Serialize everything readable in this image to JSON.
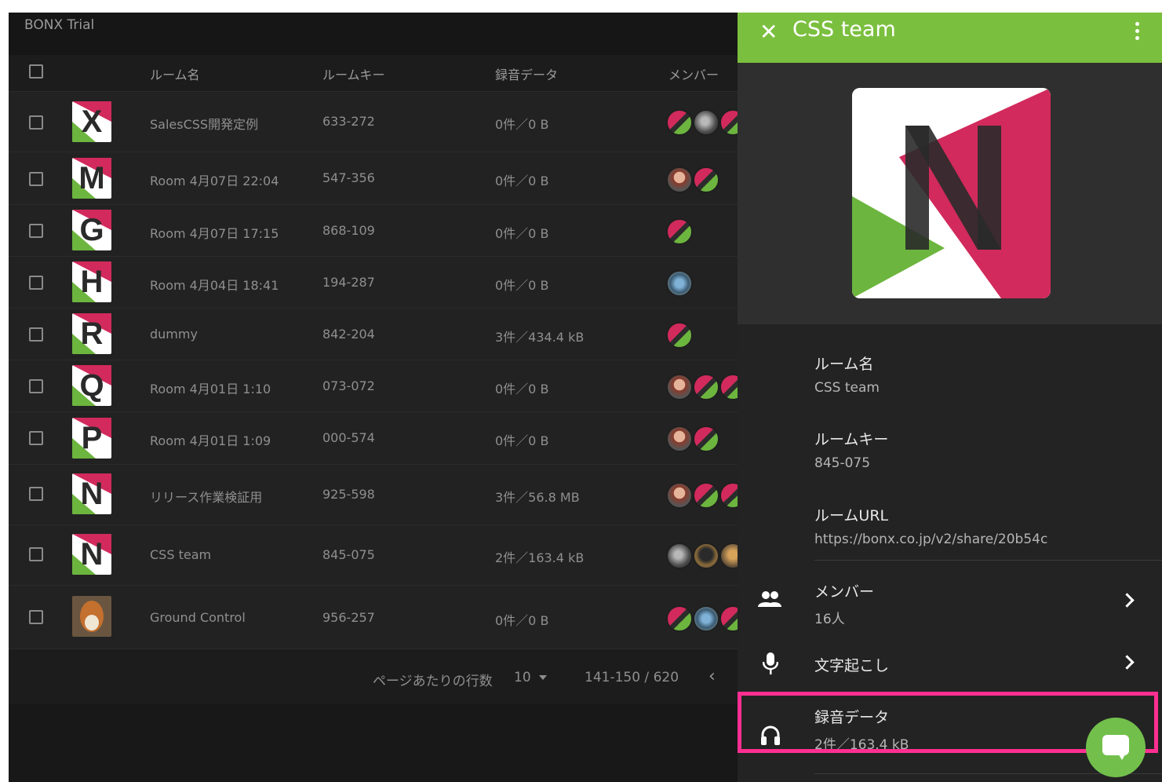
{
  "app": {
    "title": "BONX Trial"
  },
  "table": {
    "headers": {
      "name": "ルーム名",
      "key": "ルームキー",
      "recording": "録音データ",
      "members": "メンバー"
    },
    "rows": [
      {
        "avatar": "X",
        "name": "SalesCSS開発定例",
        "key": "633-272",
        "recording": "0件／0 B"
      },
      {
        "avatar": "M",
        "name": "Room 4月07日 22:04",
        "key": "547-356",
        "recording": "0件／0 B"
      },
      {
        "avatar": "G",
        "name": "Room 4月07日 17:15",
        "key": "868-109",
        "recording": "0件／0 B"
      },
      {
        "avatar": "H",
        "name": "Room 4月04日 18:41",
        "key": "194-287",
        "recording": "0件／0 B"
      },
      {
        "avatar": "R",
        "name": "dummy",
        "key": "842-204",
        "recording": "3件／434.4 kB"
      },
      {
        "avatar": "Q",
        "name": "Room 4月01日 1:10",
        "key": "073-072",
        "recording": "0件／0 B"
      },
      {
        "avatar": "P",
        "name": "Room 4月01日 1:09",
        "key": "000-574",
        "recording": "0件／0 B"
      },
      {
        "avatar": "N",
        "name": "リリース作業検証用",
        "key": "925-598",
        "recording": "3件／56.8 MB"
      },
      {
        "avatar": "N",
        "name": "CSS team",
        "key": "845-075",
        "recording": "2件／163.4 kB"
      },
      {
        "avatar": "photo",
        "name": "Ground Control",
        "key": "956-257",
        "recording": "0件／0 B"
      }
    ],
    "footer": {
      "rows_per_page_label": "ページあたりの行数",
      "rows_per_page": "10",
      "range": "141-150 / 620",
      "prev_icon": "chevron-left-icon"
    }
  },
  "panel": {
    "title": "CSS team",
    "close_icon": "close-icon",
    "menu_icon": "more-vert-icon",
    "fields": {
      "room_name": {
        "label": "ルーム名",
        "value": "CSS team"
      },
      "room_key": {
        "label": "ルームキー",
        "value": "845-075"
      },
      "room_url": {
        "label": "ルームURL",
        "value": "https://bonx.co.jp/v2/share/20b54c"
      }
    },
    "links": {
      "members": {
        "label": "メンバー",
        "value": "16人",
        "icon": "people-icon"
      },
      "transcription": {
        "label": "文字起こし",
        "icon": "microphone-icon"
      },
      "recording": {
        "label": "録音データ",
        "value": "2件／163.4 kB",
        "icon": "headphones-icon"
      }
    },
    "fab_icon": "chat-bubble-icon"
  },
  "colors": {
    "accent_green": "#7bbf3f",
    "brand_pink": "#d22a5c",
    "highlight": "#ff2f92"
  }
}
